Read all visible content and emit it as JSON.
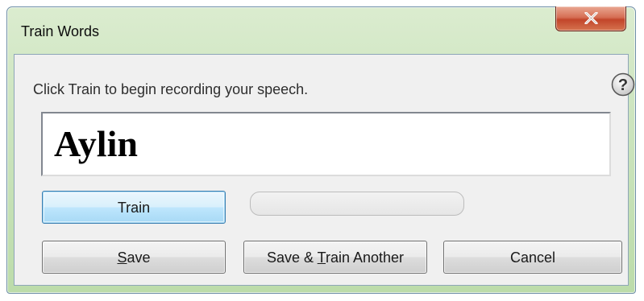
{
  "window": {
    "title": "Train Words"
  },
  "dialog": {
    "prompt": "Click Train to begin recording your speech.",
    "word": "Aylin",
    "progress": 0
  },
  "buttons": {
    "train": "Train",
    "save_prefix": "",
    "save_mnemonic": "S",
    "save_suffix": "ave",
    "save_train_prefix": "Save & ",
    "save_train_mnemonic": "T",
    "save_train_suffix": "rain Another",
    "cancel": "Cancel"
  },
  "icons": {
    "close": "close-icon",
    "help": "help-icon"
  },
  "colors": {
    "title_bar": "#cfe6c2",
    "close_button": "#c2452a",
    "default_button_border": "#3c7fb1",
    "dialog_background": "#f0f0f0"
  }
}
